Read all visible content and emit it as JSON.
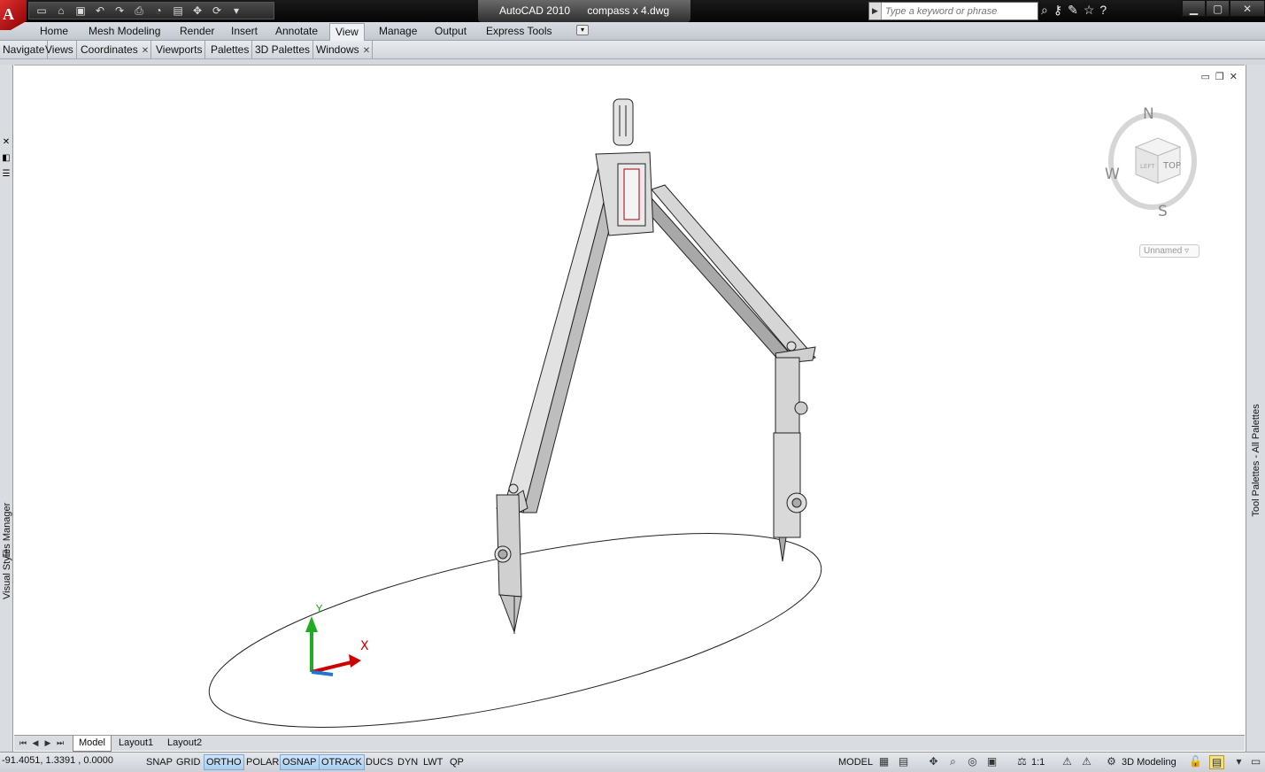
{
  "app": {
    "title": "AutoCAD 2010",
    "document": "compass x 4.dwg",
    "logo_letter": "A"
  },
  "quick_access": [
    "new-icon",
    "open-icon",
    "save-icon",
    "undo-icon",
    "redo-icon",
    "plot-icon",
    "publish-icon",
    "batch-plot-icon",
    "pan-icon",
    "orbit-icon",
    "dropdown-icon"
  ],
  "search": {
    "placeholder": "Type a keyword or phrase"
  },
  "ribbon": {
    "tabs": [
      {
        "label": "Home",
        "active": false
      },
      {
        "label": "Mesh Modeling",
        "active": false
      },
      {
        "label": "Render",
        "active": false
      },
      {
        "label": "Insert",
        "active": false
      },
      {
        "label": "Annotate",
        "active": false
      },
      {
        "label": "View",
        "active": true
      },
      {
        "label": "Manage",
        "active": false
      },
      {
        "label": "Output",
        "active": false
      },
      {
        "label": "Express Tools",
        "active": false
      }
    ]
  },
  "panels": [
    "Navigate",
    "Views",
    "Coordinates",
    "Viewports",
    "Palettes",
    "3D Palettes",
    "Windows"
  ],
  "left_palette": {
    "label": "Visual Styles Manager"
  },
  "right_palette": {
    "label": "Tool Palettes - All Palettes"
  },
  "viewcube": {
    "compass_n": "N",
    "compass_w": "W",
    "compass_s": "S",
    "face_top": "TOP",
    "face_left": "LEFT",
    "ucs_name": "Unnamed"
  },
  "ucs": {
    "x_label": "X",
    "y_label": "Y"
  },
  "layout_tabs": [
    {
      "label": "Model",
      "active": true
    },
    {
      "label": "Layout1",
      "active": false
    },
    {
      "label": "Layout2",
      "active": false
    }
  ],
  "status": {
    "coordinates": "-91.4051, 1.3391 , 0.0000",
    "toggles": [
      {
        "label": "SNAP",
        "on": false
      },
      {
        "label": "GRID",
        "on": false
      },
      {
        "label": "ORTHO",
        "on": true
      },
      {
        "label": "POLAR",
        "on": false
      },
      {
        "label": "OSNAP",
        "on": true
      },
      {
        "label": "OTRACK",
        "on": true
      },
      {
        "label": "DUCS",
        "on": false
      },
      {
        "label": "DYN",
        "on": false
      },
      {
        "label": "LWT",
        "on": false
      },
      {
        "label": "QP",
        "on": false
      }
    ],
    "space": "MODEL",
    "annotation_scale": "1:1",
    "workspace": "3D Modeling"
  },
  "colors": {
    "ucs_x": "#cc0000",
    "ucs_y": "#22aa22",
    "ucs_z": "#2277cc",
    "toggle_on": "#a9cdee"
  }
}
